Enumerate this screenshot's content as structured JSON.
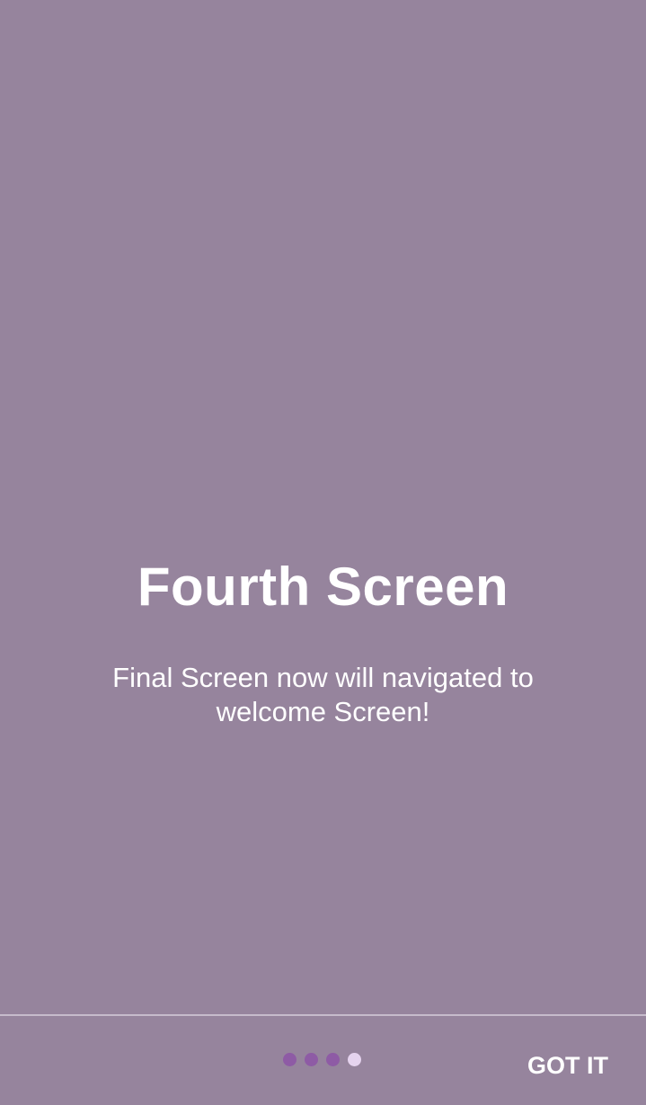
{
  "slide": {
    "title": "Fourth Screen",
    "description": "Final Screen now will navigated to welcome Screen!",
    "background_color": "#96849d"
  },
  "pager": {
    "total": 4,
    "current": 4,
    "inactive_color": "#8e5ba5",
    "active_color": "#e5d3ee"
  },
  "actions": {
    "done_label": "GOT IT"
  }
}
